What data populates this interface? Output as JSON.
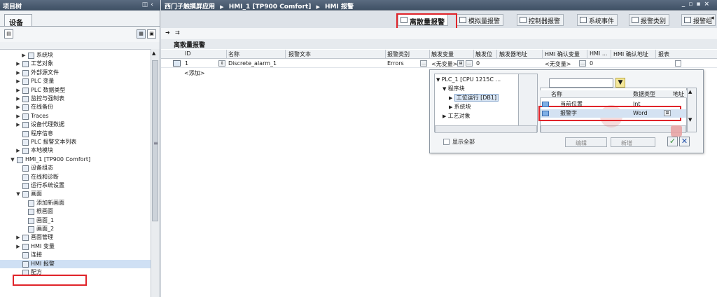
{
  "left_panel": {
    "title": "项目树",
    "tab": "设备",
    "tree": [
      {
        "label": "系统块",
        "indent": 3,
        "arrow": "▶"
      },
      {
        "label": "工艺对象",
        "indent": 2,
        "arrow": "▶"
      },
      {
        "label": "外部源文件",
        "indent": 2,
        "arrow": "▶"
      },
      {
        "label": "PLC 变量",
        "indent": 2,
        "arrow": "▶"
      },
      {
        "label": "PLC 数据类型",
        "indent": 2,
        "arrow": "▶"
      },
      {
        "label": "监控与强制表",
        "indent": 2,
        "arrow": "▶"
      },
      {
        "label": "在线备份",
        "indent": 2,
        "arrow": "▶"
      },
      {
        "label": "Traces",
        "indent": 2,
        "arrow": "▶"
      },
      {
        "label": "设备代理数据",
        "indent": 2,
        "arrow": "▶"
      },
      {
        "label": "程序信息",
        "indent": 2,
        "arrow": ""
      },
      {
        "label": "PLC 报警文本列表",
        "indent": 2,
        "arrow": ""
      },
      {
        "label": "本地模块",
        "indent": 2,
        "arrow": "▶"
      },
      {
        "label": "HMI_1 [TP900 Comfort]",
        "indent": 1,
        "arrow": "▼"
      },
      {
        "label": "设备组态",
        "indent": 2,
        "arrow": ""
      },
      {
        "label": "在线和诊断",
        "indent": 2,
        "arrow": ""
      },
      {
        "label": "运行系统设置",
        "indent": 2,
        "arrow": ""
      },
      {
        "label": "画面",
        "indent": 2,
        "arrow": "▼"
      },
      {
        "label": "添加新画面",
        "indent": 3,
        "arrow": ""
      },
      {
        "label": "根画面",
        "indent": 3,
        "arrow": ""
      },
      {
        "label": "画面_1",
        "indent": 3,
        "arrow": ""
      },
      {
        "label": "画面_2",
        "indent": 3,
        "arrow": ""
      },
      {
        "label": "画面管理",
        "indent": 2,
        "arrow": "▶"
      },
      {
        "label": "HMI 变量",
        "indent": 2,
        "arrow": "▶"
      },
      {
        "label": "连接",
        "indent": 2,
        "arrow": ""
      },
      {
        "label": "HMI 报警",
        "indent": 2,
        "arrow": "",
        "selected": true
      },
      {
        "label": "配方",
        "indent": 2,
        "arrow": ""
      }
    ]
  },
  "breadcrumb": {
    "parts": [
      "西门子触摸屏应用",
      "HMI_1 [TP900 Comfort]",
      "HMI 报警"
    ],
    "sep": "▶"
  },
  "tabs": [
    "离散量报警",
    "模拟量报警",
    "控制器报警",
    "系统事件",
    "报警类别",
    "报警组"
  ],
  "section_title": "离散量报警",
  "columns": [
    "ID",
    "名称",
    "报警文本",
    "报警类别",
    "触发变量",
    "触发位",
    "触发器地址",
    "HMI 确认变量",
    "HMI ...",
    "HMI 确认地址",
    "报表"
  ],
  "rows": [
    {
      "id": "1",
      "name": "Discrete_alarm_1",
      "text": "",
      "class": "Errors",
      "trigger_tag": "<无变量>",
      "trigger_bit": "0",
      "trigger_addr": "",
      "ack_tag": "<无变量>",
      "ack_bit": "0",
      "ack_addr": ""
    }
  ],
  "add_row": "<添加>",
  "popup": {
    "tree": [
      {
        "label": "PLC_1 [CPU 1215C ...",
        "arrow": "▼"
      },
      {
        "label": "程序块",
        "arrow": "▼"
      },
      {
        "label": "工位运行 [DB1]",
        "arrow": "▶",
        "selected": true
      },
      {
        "label": "系统块",
        "arrow": "▶"
      },
      {
        "label": "工艺对象",
        "arrow": "▶"
      }
    ],
    "list_headers": [
      "名称",
      "数据类型",
      "地址"
    ],
    "list_rows": [
      {
        "name": "当前位置",
        "type": "Int"
      },
      {
        "name": "报警字",
        "type": "Word",
        "selected": true
      }
    ],
    "show_all": "显示全部",
    "edit": "编辑",
    "new": "新增",
    "ok": "✓",
    "cancel": "✕"
  }
}
